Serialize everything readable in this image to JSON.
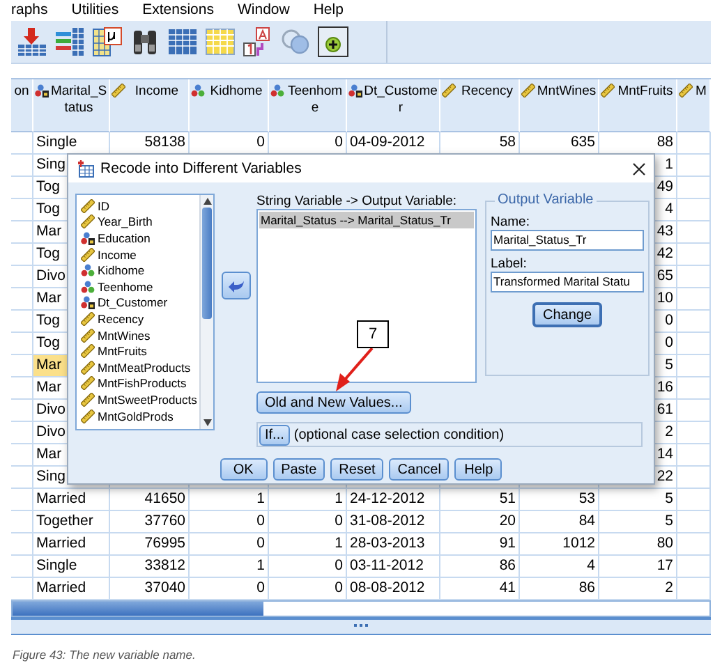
{
  "menu": [
    "raphs",
    "Utilities",
    "Extensions",
    "Window",
    "Help"
  ],
  "grid": {
    "columns": [
      {
        "label": "on",
        "kind": "none"
      },
      {
        "label": "Marital_Status",
        "kind": "string"
      },
      {
        "label": "Income",
        "kind": "scale"
      },
      {
        "label": "Kidhome",
        "kind": "nominal"
      },
      {
        "label": "Teenhome",
        "kind": "nominal"
      },
      {
        "label": "Dt_Customer",
        "kind": "string"
      },
      {
        "label": "Recency",
        "kind": "scale"
      },
      {
        "label": "MntWines",
        "kind": "scale"
      },
      {
        "label": "MntFruits",
        "kind": "scale"
      },
      {
        "label": "M",
        "kind": "scale"
      }
    ],
    "rows": [
      {
        "selected": false,
        "cells": [
          "",
          "Single",
          "58138",
          "0",
          "0",
          "04-09-2012",
          "58",
          "635",
          "88",
          ""
        ]
      },
      {
        "selected": false,
        "cells": [
          "",
          "Sing",
          "",
          "",
          "",
          "",
          "",
          "",
          "1",
          ""
        ]
      },
      {
        "selected": false,
        "cells": [
          "",
          "Tog",
          "",
          "",
          "",
          "",
          "",
          "",
          "49",
          ""
        ]
      },
      {
        "selected": false,
        "cells": [
          "",
          "Tog",
          "",
          "",
          "",
          "",
          "",
          "",
          "4",
          ""
        ]
      },
      {
        "selected": false,
        "cells": [
          "",
          "Mar",
          "",
          "",
          "",
          "",
          "",
          "",
          "43",
          ""
        ]
      },
      {
        "selected": false,
        "cells": [
          "",
          "Tog",
          "",
          "",
          "",
          "",
          "",
          "",
          "42",
          ""
        ]
      },
      {
        "selected": false,
        "cells": [
          "",
          "Divo",
          "",
          "",
          "",
          "",
          "",
          "",
          "65",
          ""
        ]
      },
      {
        "selected": false,
        "cells": [
          "",
          "Mar",
          "",
          "",
          "",
          "",
          "",
          "",
          "10",
          ""
        ]
      },
      {
        "selected": false,
        "cells": [
          "",
          "Tog",
          "",
          "",
          "",
          "",
          "",
          "",
          "0",
          ""
        ]
      },
      {
        "selected": false,
        "cells": [
          "",
          "Tog",
          "",
          "",
          "",
          "",
          "",
          "",
          "0",
          ""
        ]
      },
      {
        "selected": true,
        "cells": [
          "",
          "Mar",
          "",
          "",
          "",
          "",
          "",
          "",
          "5",
          ""
        ]
      },
      {
        "selected": false,
        "cells": [
          "",
          "Mar",
          "",
          "",
          "",
          "",
          "",
          "",
          "16",
          ""
        ]
      },
      {
        "selected": false,
        "cells": [
          "",
          "Divo",
          "",
          "",
          "",
          "",
          "",
          "",
          "61",
          ""
        ]
      },
      {
        "selected": false,
        "cells": [
          "",
          "Divo",
          "",
          "",
          "",
          "",
          "",
          "",
          "2",
          ""
        ]
      },
      {
        "selected": false,
        "cells": [
          "",
          "Mar",
          "",
          "",
          "",
          "",
          "",
          "",
          "14",
          ""
        ]
      },
      {
        "selected": false,
        "cells": [
          "",
          "Sing",
          "",
          "",
          "",
          "",
          "",
          "",
          "22",
          ""
        ]
      },
      {
        "selected": false,
        "cells": [
          "",
          "Married",
          "41650",
          "1",
          "1",
          "24-12-2012",
          "51",
          "53",
          "5",
          ""
        ]
      },
      {
        "selected": false,
        "cells": [
          "",
          "Together",
          "37760",
          "0",
          "0",
          "31-08-2012",
          "20",
          "84",
          "5",
          ""
        ]
      },
      {
        "selected": false,
        "cells": [
          "",
          "Married",
          "76995",
          "0",
          "1",
          "28-03-2013",
          "91",
          "1012",
          "80",
          ""
        ]
      },
      {
        "selected": false,
        "cells": [
          "",
          "Single",
          "33812",
          "1",
          "0",
          "03-11-2012",
          "86",
          "4",
          "17",
          ""
        ]
      },
      {
        "selected": false,
        "cells": [
          "",
          "Married",
          "37040",
          "0",
          "0",
          "08-08-2012",
          "41",
          "86",
          "2",
          ""
        ]
      }
    ]
  },
  "dialog": {
    "title": "Recode into Different Variables",
    "variables": [
      {
        "name": "ID",
        "kind": "scale"
      },
      {
        "name": "Year_Birth",
        "kind": "scale"
      },
      {
        "name": "Education",
        "kind": "string"
      },
      {
        "name": "Income",
        "kind": "scale"
      },
      {
        "name": "Kidhome",
        "kind": "nominal"
      },
      {
        "name": "Teenhome",
        "kind": "nominal"
      },
      {
        "name": "Dt_Customer",
        "kind": "string"
      },
      {
        "name": "Recency",
        "kind": "scale"
      },
      {
        "name": "MntWines",
        "kind": "scale"
      },
      {
        "name": "MntFruits",
        "kind": "scale"
      },
      {
        "name": "MntMeatProducts",
        "kind": "scale"
      },
      {
        "name": "MntFishProducts",
        "kind": "scale"
      },
      {
        "name": "MntSweetProducts",
        "kind": "scale"
      },
      {
        "name": "MntGoldProds",
        "kind": "scale"
      }
    ],
    "mapping_label": "String Variable -> Output Variable:",
    "mappings": [
      {
        "text": "Marital_Status --> Marital_Status_Tr",
        "selected": true
      }
    ],
    "old_new_button": "Old and New Values...",
    "if_button": "If...",
    "if_note": "(optional case selection condition)",
    "output": {
      "title": "Output Variable",
      "name_label": "Name:",
      "name_value": "Marital_Status_Tr",
      "label_label": "Label:",
      "label_value": "Transformed Marital Statu",
      "change_button": "Change"
    },
    "buttons": [
      "OK",
      "Paste",
      "Reset",
      "Cancel",
      "Help"
    ]
  },
  "callout": {
    "text": "7"
  },
  "caption": "Figure 43: The new variable name."
}
